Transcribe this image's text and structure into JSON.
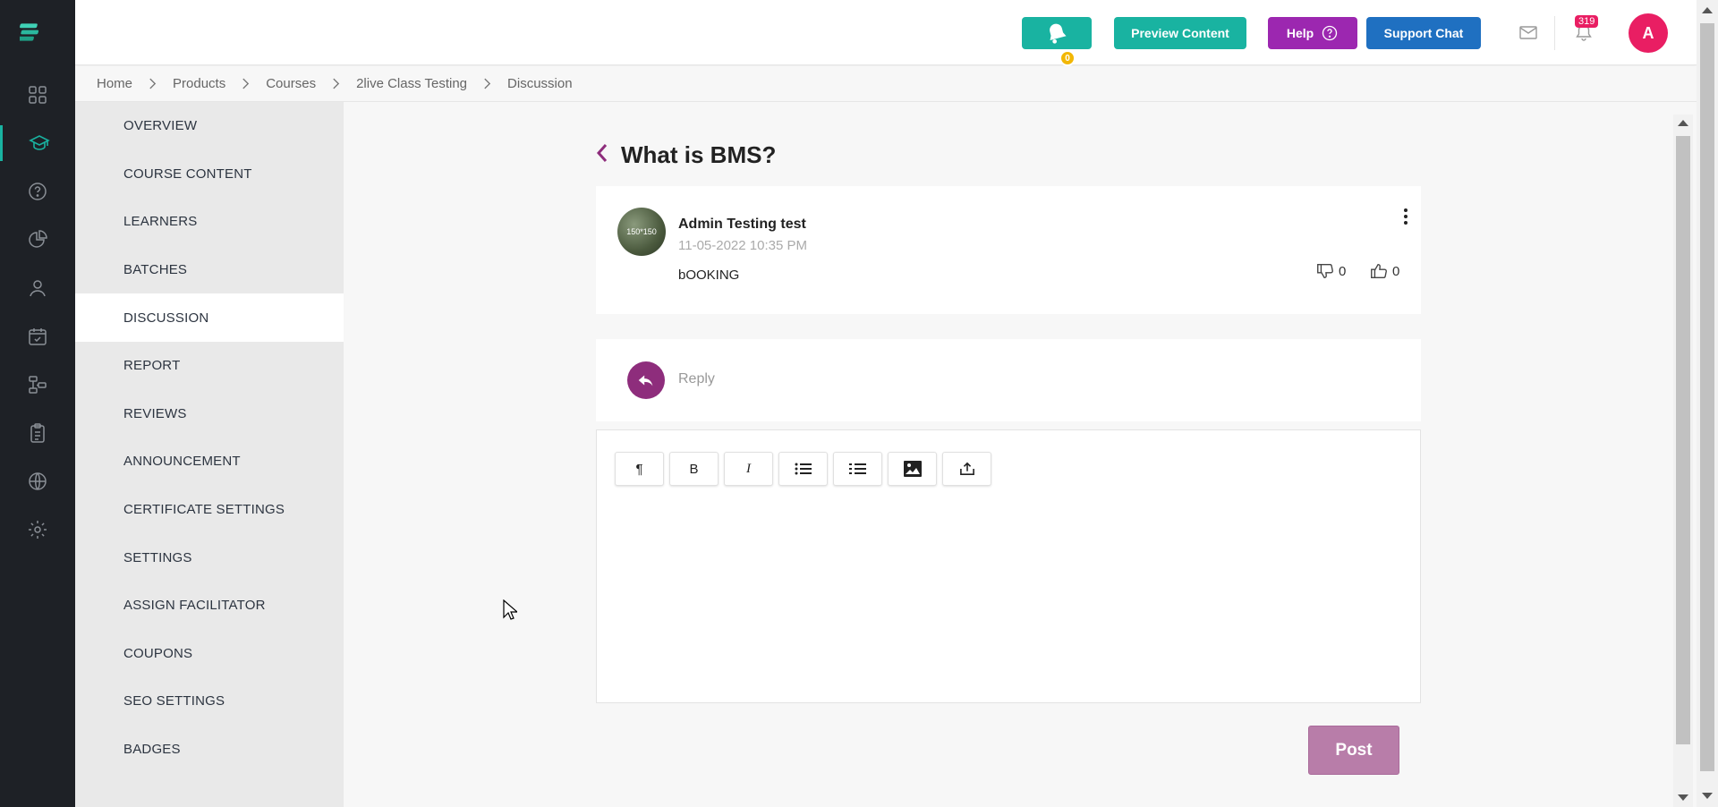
{
  "rail": {
    "items": [
      {
        "icon": "dashboard-grid-icon"
      },
      {
        "icon": "graduation-cap-icon",
        "active": true
      },
      {
        "icon": "question-circle-icon"
      },
      {
        "icon": "pie-chart-icon"
      },
      {
        "icon": "user-icon"
      },
      {
        "icon": "calendar-check-icon"
      },
      {
        "icon": "workflow-icon"
      },
      {
        "icon": "clipboard-icon"
      },
      {
        "icon": "globe-icon"
      },
      {
        "icon": "gear-icon"
      }
    ],
    "accent": "#19b3a1"
  },
  "topbar": {
    "bell_badge": "0",
    "preview_label": "Preview Content",
    "help_label": "Help",
    "support_label": "Support Chat",
    "notif_count": "319",
    "avatar_initial": "A"
  },
  "breadcrumb": [
    "Home",
    "Products",
    "Courses",
    "2live Class Testing",
    "Discussion"
  ],
  "course_menu": [
    "OVERVIEW",
    "COURSE CONTENT",
    "LEARNERS",
    "BATCHES",
    "DISCUSSION",
    "REPORT",
    "REVIEWS",
    "ANNOUNCEMENT",
    "CERTIFICATE SETTINGS",
    "SETTINGS",
    "ASSIGN FACILITATOR",
    "COUPONS",
    "SEO SETTINGS",
    "BADGES"
  ],
  "discussion": {
    "title": "What is BMS?",
    "post": {
      "avatar_text": "150*150",
      "author": "Admin Testing test",
      "date": "11-05-2022 10:35 PM",
      "body": "bOOKING",
      "dislikes": "0",
      "likes": "0"
    },
    "reply_placeholder": "Reply",
    "toolbar": [
      "¶",
      "B",
      "I"
    ],
    "post_label": "Post"
  },
  "colors": {
    "teal": "#19b3a1",
    "purple": "#9c27b0",
    "blue": "#1f70c1",
    "pink": "#e91e63",
    "plum": "#8e2d7c"
  }
}
